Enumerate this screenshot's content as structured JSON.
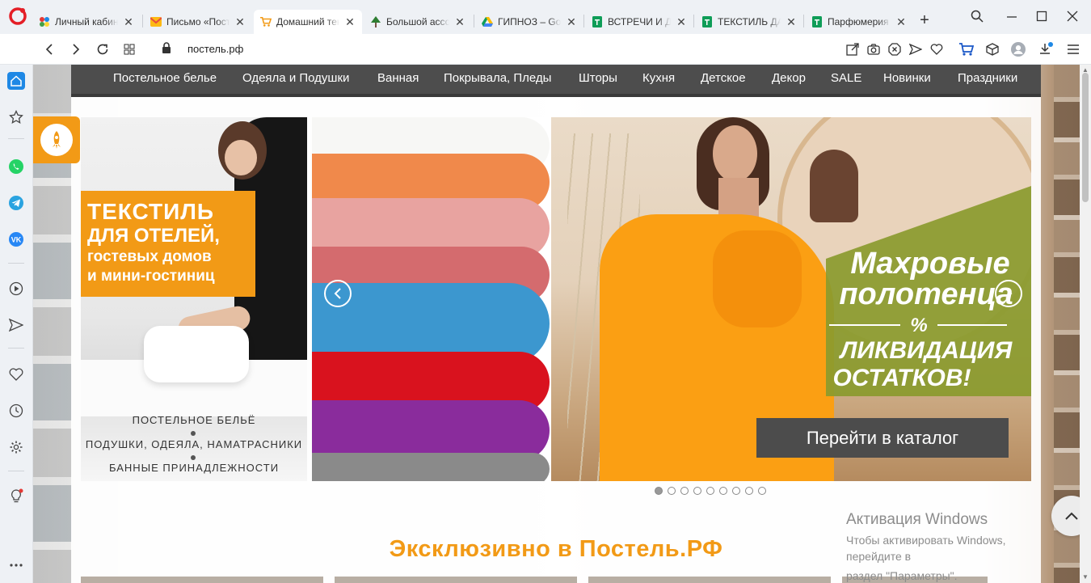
{
  "tabs": [
    {
      "title": "Личный кабинет",
      "icon": "colorful-dots-icon",
      "active": false
    },
    {
      "title": "Письмо «Постель»",
      "icon": "mail-icon",
      "active": false
    },
    {
      "title": "Домашний текстиль",
      "icon": "cart-icon",
      "active": true
    },
    {
      "title": "Большой ассортимент",
      "icon": "tree-icon",
      "active": false
    },
    {
      "title": "ГИПНОЗ – Google Диск",
      "icon": "google-drive-icon",
      "active": false
    },
    {
      "title": "ВСТРЕЧИ И ДОСТАВКИ",
      "icon": "sheets-icon",
      "active": false
    },
    {
      "title": "ТЕКСТИЛЬ ДАЧА",
      "icon": "sheets-icon",
      "active": false
    },
    {
      "title": "Парфюмерия и",
      "icon": "sheets-icon",
      "active": false
    }
  ],
  "address": {
    "url": "постель.рф"
  },
  "nav": [
    "Постельное белье",
    "Одеяла и Подушки",
    "Ванная",
    "Покрывала, Пледы",
    "Шторы",
    "Кухня",
    "Детское",
    "Декор",
    "SALE",
    "Новинки",
    "Праздники"
  ],
  "hotel_banner": {
    "line1": "ТЕКСТИЛЬ",
    "line2": "ДЛЯ ОТЕЛЕЙ,",
    "line3": "гостевых домов",
    "line4": "и мини-гостиниц",
    "list": [
      "ПОСТЕЛЬНОЕ БЕЛЬЁ",
      "ПОДУШКИ, ОДЕЯЛА, НАМАТРАСНИКИ",
      "БАННЫЕ ПРИНАДЛЕЖНОСТИ"
    ]
  },
  "slider": {
    "promo_title1": "Махровые",
    "promo_title2": "полотенца",
    "promo_percent": "%",
    "promo_sub1": "ЛИКВИДАЦИЯ",
    "promo_sub2": "ОСТАТКОВ!",
    "cta": "Перейти в каталог",
    "slide_count": 9,
    "active_slide": 1
  },
  "section_title": "Эксклюзивно в Постель.РФ",
  "activation": {
    "title": "Активация Windows",
    "line1": "Чтобы активировать Windows, перейдите в",
    "line2": "раздел \"Параметры\"."
  },
  "colors": {
    "accent": "#f29a16",
    "nav_bg": "#4d4d4d",
    "promo_green": "#8a9a2e"
  }
}
